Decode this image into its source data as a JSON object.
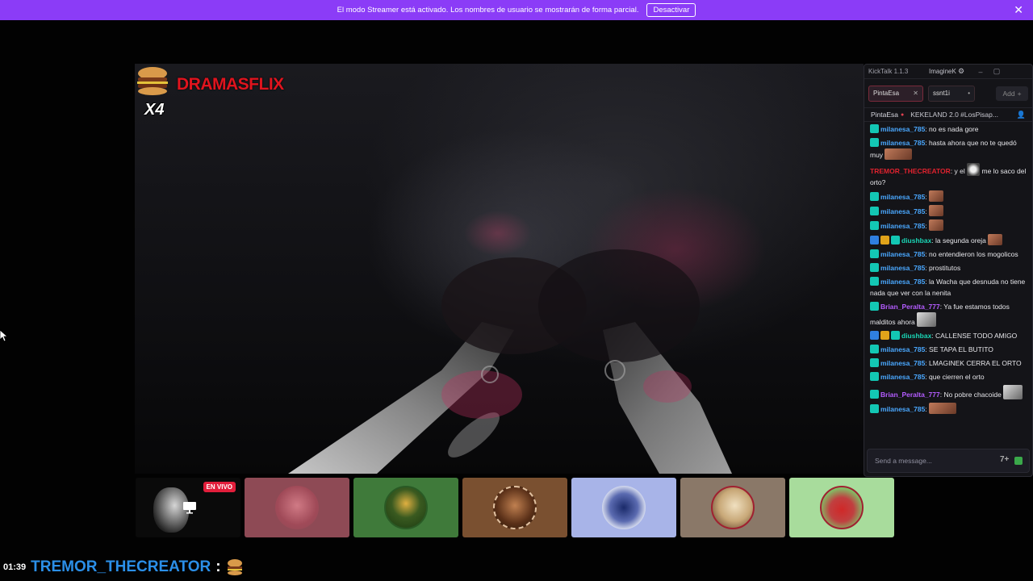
{
  "banner": {
    "text": "El modo Streamer está activado. Los nombres de usuario se mostrarán de forma parcial.",
    "button_label": "Desactivar",
    "close_glyph": "✕"
  },
  "overlay": {
    "logo_text": "DRAMASFLIX",
    "logo_sub": "X4"
  },
  "tiles": {
    "live_label": "EN VIVO",
    "colors": [
      "#0a0a0a",
      "#8e4a55",
      "#3f7a3a",
      "#7a5030",
      "#a8b4e8",
      "#8a7868",
      "#a8dc9c"
    ]
  },
  "caption": {
    "time": "01:39",
    "username": "TREMOR_THECREATOR",
    "colon": ":"
  },
  "kicktalk": {
    "title": "KickTalk 1.1.3",
    "user": "ImagineK",
    "gear_icon": "⚙",
    "minimize": "–",
    "maximize": "▢",
    "tabs": [
      {
        "label": "PintaEsa",
        "close": "✕"
      },
      {
        "label": "ssnt1i",
        "close": "•"
      }
    ],
    "add_label": "Add",
    "add_icon": "+",
    "channel": {
      "name": "PintaEsa",
      "dot": "●",
      "stream_title": "KEKELAND 2.0 #LosPisap..."
    },
    "input_placeholder": "Send a message...",
    "messages": [
      {
        "user": "milanesa_785",
        "color": "#4aa8ff",
        "text": "no es nada gore"
      },
      {
        "user": "milanesa_785",
        "color": "#4aa8ff",
        "text": "hasta ahora que no te quedó muy"
      },
      {
        "user": "TREMOR_THECREATOR",
        "color": "#e0222e",
        "text": "y el",
        "text2": "me lo saco del orto?"
      },
      {
        "user": "milanesa_785",
        "color": "#4aa8ff",
        "text": ""
      },
      {
        "user": "milanesa_785",
        "color": "#4aa8ff",
        "text": ""
      },
      {
        "user": "milanesa_785",
        "color": "#4aa8ff",
        "text": ""
      },
      {
        "user": "diushbax",
        "color": "#1ad6b6",
        "text": "la segunda oreja"
      },
      {
        "user": "milanesa_785",
        "color": "#4aa8ff",
        "text": "no entendieron los mogolicos"
      },
      {
        "user": "milanesa_785",
        "color": "#4aa8ff",
        "text": "prostitutos"
      },
      {
        "user": "milanesa_785",
        "color": "#4aa8ff",
        "text": "la Wacha que desnuda no tiene nada que ver con la nenita"
      },
      {
        "user": "Brian_Peralta_777",
        "color": "#b45cff",
        "text": "Ya fue estamos todos malditos ahora"
      },
      {
        "user": "diushbax",
        "color": "#1ad6b6",
        "text": "CALLENSE TODO AMIGO"
      },
      {
        "user": "milanesa_785",
        "color": "#4aa8ff",
        "text": "SE TAPA EL BUTITO"
      },
      {
        "user": "milanesa_785",
        "color": "#4aa8ff",
        "text": "LMAGINEK CERRA EL ORTO"
      },
      {
        "user": "milanesa_785",
        "color": "#4aa8ff",
        "text": "que cierren el orto"
      },
      {
        "user": "Brian_Peralta_777",
        "color": "#b45cff",
        "text": "No pobre chacoide"
      },
      {
        "user": "milanesa_785",
        "color": "#4aa8ff",
        "text": ""
      }
    ]
  }
}
